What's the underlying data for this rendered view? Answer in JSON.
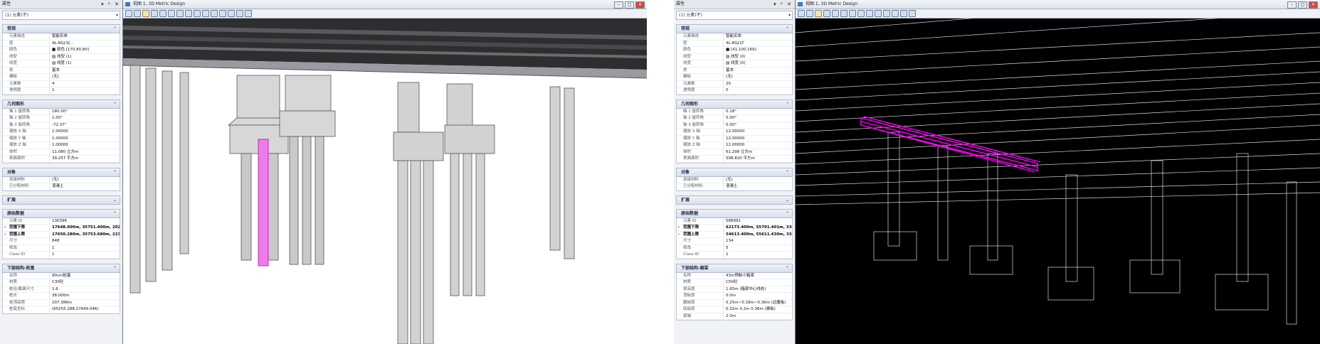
{
  "left": {
    "panel_title": "属性",
    "selector": "(1) 元素(不)",
    "viewport_title": "视图 1, 3D Metric Design",
    "sections": [
      {
        "title": "常规",
        "rows": [
          {
            "k": "元素描述",
            "v": "智能实体"
          },
          {
            "k": "层",
            "v": "4L-RGJ-S[..."
          },
          {
            "k": "颜色",
            "v": "■ 颜色 [170,80,80]"
          },
          {
            "k": "线型",
            "v": "▨ 线型 (1)"
          },
          {
            "k": "线宽",
            "v": "▨ 线宽 (1)"
          },
          {
            "k": "类",
            "v": "基本"
          },
          {
            "k": "模板",
            "v": "(无)"
          },
          {
            "k": "元素数",
            "v": "4"
          },
          {
            "k": "透明度",
            "v": "1"
          }
        ]
      },
      {
        "title": "几何图形",
        "rows": [
          {
            "k": "轴 1 旋转角",
            "v": "180.00°"
          },
          {
            "k": "轴 2 旋转角",
            "v": "1.00°"
          },
          {
            "k": "轴 3 旋转角",
            "v": "-72.37°"
          },
          {
            "k": "缩放 X 轴",
            "v": "1.00000"
          },
          {
            "k": "缩放 Y 轴",
            "v": "1.00000"
          },
          {
            "k": "缩放 Z 轴",
            "v": "1.00000"
          },
          {
            "k": "体积",
            "v": "11.080 立方m"
          },
          {
            "k": "表面面积",
            "v": "39.257 平方m"
          }
        ]
      },
      {
        "title": "对象",
        "rows": [
          {
            "k": "连接材料",
            "v": "(无)"
          },
          {
            "k": "已分配材料",
            "v": "混凝土"
          }
        ]
      },
      {
        "title": "扩展",
        "collapsed": true,
        "rows": []
      },
      {
        "title": "原始数据",
        "rows": [
          {
            "k": "元素 ID",
            "v": "130396"
          },
          {
            "k": "范围下限",
            "v": "17648.600m, 35751.400m, 202.1",
            "bold": true,
            "arrow": true
          },
          {
            "k": "范围上限",
            "v": "17650.280m, 35753.680m, 223.1",
            "bold": true,
            "arrow": true
          },
          {
            "k": "尺寸",
            "v": "848"
          },
          {
            "k": "修改",
            "v": "1"
          },
          {
            "k": "Class ID",
            "v": "1"
          }
        ]
      },
      {
        "title": "下部结构-桩基",
        "rows": [
          {
            "k": "名称",
            "v": "90cm桩基"
          },
          {
            "k": "材质",
            "v": "C30砼"
          },
          {
            "k": "桩径/截面尺寸",
            "v": "1.6"
          },
          {
            "k": "桩长",
            "v": "38.000m"
          },
          {
            "k": "桩顶高程",
            "v": "207.386m"
          },
          {
            "k": "桩底坐标",
            "v": "(65255.288,17649.046)"
          }
        ]
      }
    ]
  },
  "right": {
    "panel_title": "属性",
    "selector": "(1) 元素(不)",
    "viewport_title": "视图 1, 3D Metric Design",
    "sections": [
      {
        "title": "常规",
        "rows": [
          {
            "k": "元素描述",
            "v": "智能实体"
          },
          {
            "k": "层",
            "v": "4L-RGJ-LT"
          },
          {
            "k": "颜色",
            "v": "■ [41,100,169]"
          },
          {
            "k": "线型",
            "v": "▨ 线型 (0)"
          },
          {
            "k": "线宽",
            "v": "▨ 线宽 (0)"
          },
          {
            "k": "类",
            "v": "基本"
          },
          {
            "k": "模板",
            "v": "(无)"
          },
          {
            "k": "元素数",
            "v": "20"
          },
          {
            "k": "透明度",
            "v": "0"
          }
        ]
      },
      {
        "title": "几何图形",
        "rows": [
          {
            "k": "轴 1 旋转角",
            "v": "0.18°"
          },
          {
            "k": "轴 2 旋转角",
            "v": "0.00°"
          },
          {
            "k": "轴 3 旋转角",
            "v": "0.00°"
          },
          {
            "k": "缩放 X 轴",
            "v": "12.00000"
          },
          {
            "k": "缩放 Y 轴",
            "v": "12.00000"
          },
          {
            "k": "缩放 Z 轴",
            "v": "12.00000"
          },
          {
            "k": "体积",
            "v": "61.298 立方m"
          },
          {
            "k": "表面面积",
            "v": "598.820 平方m"
          }
        ]
      },
      {
        "title": "对象",
        "rows": [
          {
            "k": "连接材料",
            "v": "(无)"
          },
          {
            "k": "已分配材料",
            "v": "混凝土"
          }
        ]
      },
      {
        "title": "扩展",
        "collapsed": true,
        "rows": []
      },
      {
        "title": "原始数据",
        "rows": [
          {
            "k": "元素 ID",
            "v": "588991"
          },
          {
            "k": "范围下限",
            "v": "62173.400m, 55791.401m, 330.",
            "bold": true,
            "arrow": true
          },
          {
            "k": "范围上限",
            "v": "54613.400m, 55611.430m, 332.",
            "bold": true,
            "arrow": true
          },
          {
            "k": "尺寸",
            "v": "134"
          },
          {
            "k": "修改",
            "v": "5"
          },
          {
            "k": "Class ID",
            "v": "1"
          }
        ]
      },
      {
        "title": "下部结构-箱梁",
        "rows": [
          {
            "k": "名称",
            "v": "43m预制小箱梁"
          },
          {
            "k": "材质",
            "v": "C50砼"
          },
          {
            "k": "梁高度",
            "v": "1.65m (箱梁中心线处)"
          },
          {
            "k": "顶板厚",
            "v": "0.0m"
          },
          {
            "k": "腹板厚",
            "v": "0.25m~0.18m~0.36m (边腹板)"
          },
          {
            "k": "底板厚",
            "v": "0.32m 0.2m 0.36m (翼板)"
          },
          {
            "k": "梁端",
            "v": "2.0m"
          }
        ]
      }
    ]
  }
}
